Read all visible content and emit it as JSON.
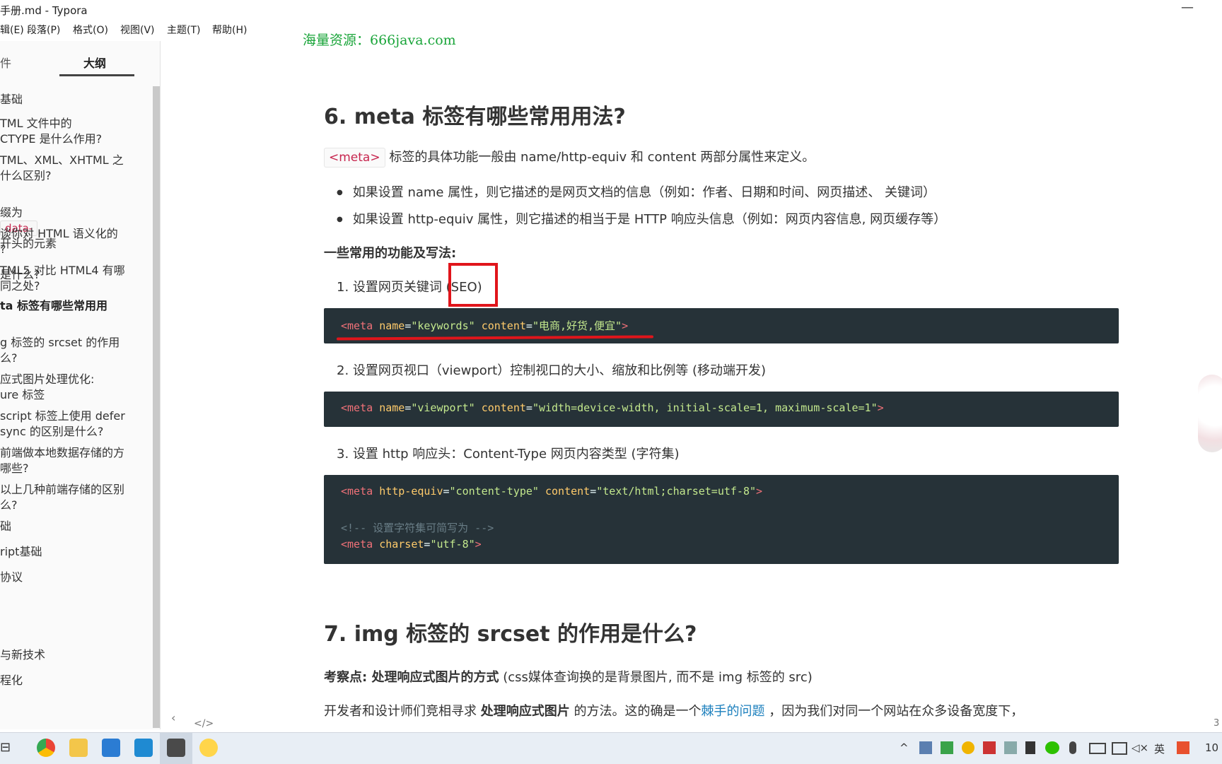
{
  "window": {
    "title": "手册.md - Typora",
    "minimize": "—"
  },
  "menu": [
    "辑(E)",
    "段落(P)",
    "格式(O)",
    "视图(V)",
    "主题(T)",
    "帮助(H)"
  ],
  "watermark": "海量资源：666java.com",
  "sidebar": {
    "tabs": [
      "件",
      "大纲"
    ],
    "items": [
      "基础",
      "TML 文件中的\nCTYPE 是什么作用?",
      "TML、XML、XHTML 之\n什么区别?",
      "ta 标签有哪些常用用",
      "g 标签的 srcset 的作用\n么?",
      "应式图片处理优化:\nure 标签",
      "script 标签上使用 defer\nsync 的区别是什么?",
      "前端做本地数据存储的方\n哪些?",
      "以上几种前端存储的区别\n么?",
      "础",
      "ript基础",
      "协议",
      "与新技术",
      "程化"
    ],
    "data_item": {
      "prefix": "缀为",
      "tag": "data-",
      "suffix": "开头的元素",
      "line2": "是什么?"
    },
    "sem_item": "谈你对 HTML 语义化的\n?",
    "h5_item": "TML5 对比 HTML4 有哪\n同之处?",
    "footer": {
      "prev": "‹",
      "source": "</>"
    }
  },
  "content": {
    "h6": "6. meta 标签有哪些常用用法?",
    "intro_tag": "<meta>",
    "intro_text": "标签的具体功能一般由 name/http-equiv 和 content 两部分属性来定义。",
    "bullets": [
      "如果设置 name 属性，则它描述的是网页文档的信息（例如：作者、日期和时间、网页描述、 关键词）",
      "如果设置 http-equiv 属性，则它描述的相当于是 HTTP 响应头信息（例如：网页内容信息, 网页缓存等）"
    ],
    "common_heading": "一些常用的功能及写法:",
    "steps": [
      "1. 设置网页关键词 (SEO)",
      "2. 设置网页视口（viewport）控制视口的大小、缩放和比例等 (移动端开发)",
      "3. 设置 http 响应头：Content-Type 网页内容类型 (字符集)"
    ],
    "code1": {
      "tag_open": "<meta",
      "a1": "name",
      "v1": "\"keywords\"",
      "a2": "content",
      "v2": "\"电商,好货,便宜\"",
      "close": ">"
    },
    "code2": {
      "tag_open": "<meta",
      "a1": "name",
      "v1": "\"viewport\"",
      "a2": "content",
      "v2": "\"width=device-width, initial-scale=1, maximum-scale=1\"",
      "close": ">"
    },
    "code3": {
      "tag_open": "<meta",
      "a1": "http-equiv",
      "v1": "\"content-type\"",
      "a2": "content",
      "v2": "\"text/html;charset=utf-8\"",
      "close": ">",
      "comment": "<!-- 设置字符集可简写为 -->",
      "tag_open2": "<meta",
      "a3": "charset",
      "v3": "\"utf-8\"",
      "close2": ">"
    },
    "h7": "7. img 标签的 srcset 的作用是什么?",
    "focus_label": "考察点: 处理响应式图片的方式",
    "focus_note": " (css媒体查询换的是背景图片, 而不是 img 标签的 src)",
    "p_start": "开发者和设计师们竞相寻求 ",
    "p_bold": "处理响应式图片",
    "p_mid": " 的方法。这的确是一个",
    "p_link": "棘手的问题",
    "p_end": " ，因为我们对同一个网站在众多设备宽度下，",
    "page_num": "3"
  },
  "taskbar": {
    "tray_lang": "英",
    "clock": "10"
  }
}
